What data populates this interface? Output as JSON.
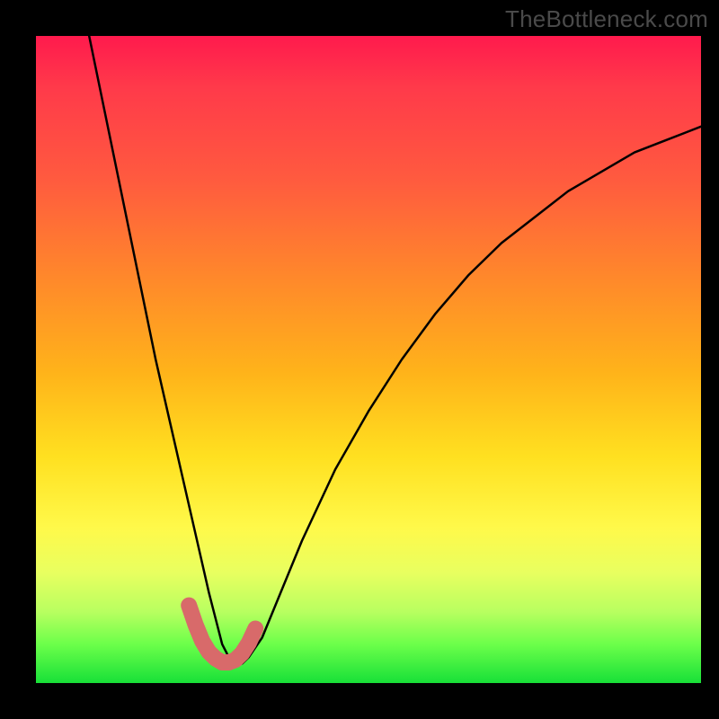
{
  "watermark": "TheBottleneck.com",
  "chart_data": {
    "type": "line",
    "title": "",
    "xlabel": "",
    "ylabel": "",
    "xlim": [
      0,
      100
    ],
    "ylim": [
      0,
      100
    ],
    "series": [
      {
        "name": "bottleneck-curve",
        "x": [
          8,
          10,
          12,
          14,
          16,
          18,
          20,
          22,
          24,
          26,
          27,
          28,
          29,
          30,
          31,
          32,
          34,
          36,
          40,
          45,
          50,
          55,
          60,
          65,
          70,
          75,
          80,
          85,
          90,
          95,
          100
        ],
        "y": [
          100,
          90,
          80,
          70,
          60,
          50,
          41,
          32,
          23,
          14,
          10,
          6,
          4,
          3,
          3,
          4,
          7,
          12,
          22,
          33,
          42,
          50,
          57,
          63,
          68,
          72,
          76,
          79,
          82,
          84,
          86
        ]
      },
      {
        "name": "highlight-segment",
        "x": [
          23,
          24,
          25,
          26,
          27,
          28,
          29,
          30,
          31,
          32,
          33
        ],
        "y": [
          12,
          9,
          6.5,
          4.8,
          3.8,
          3.2,
          3.2,
          3.6,
          4.6,
          6.2,
          8.4
        ]
      }
    ],
    "gradient_stops": [
      {
        "pos": 0,
        "color": "#ff1a4d"
      },
      {
        "pos": 22,
        "color": "#ff5a3f"
      },
      {
        "pos": 52,
        "color": "#ffb31a"
      },
      {
        "pos": 76,
        "color": "#fff94a"
      },
      {
        "pos": 100,
        "color": "#18e038"
      }
    ]
  }
}
